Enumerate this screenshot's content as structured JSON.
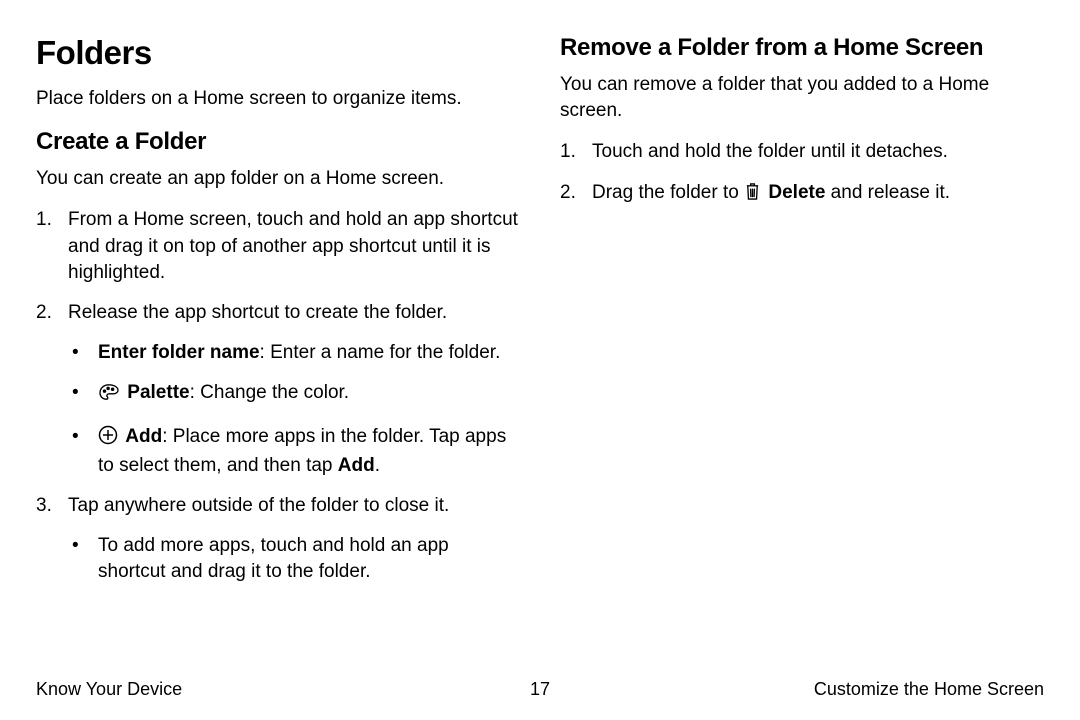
{
  "left": {
    "title": "Folders",
    "intro": "Place folders on a Home screen to organize items.",
    "createHeading": "Create a Folder",
    "createIntro": "You can create an app folder on a Home screen.",
    "steps": {
      "s1": "From a Home screen, touch and hold an app shortcut and drag it on top of another app shortcut until it is highlighted.",
      "s2": "Release the app shortcut to create the folder.",
      "s2b1_label": "Enter folder name",
      "s2b1_rest": ": Enter a name for the folder.",
      "s2b2_label": "Palette",
      "s2b2_rest": ": Change the color.",
      "s2b3_label": "Add",
      "s2b3_rest1": ": Place more apps in the folder. Tap apps to select them, and then tap ",
      "s2b3_add": "Add",
      "s2b3_rest2": ".",
      "s3": "Tap anywhere outside of the folder to close it.",
      "s3b1": "To add more apps, touch and hold an app shortcut and drag it to the folder."
    }
  },
  "right": {
    "heading": "Remove a Folder from a Home Screen",
    "intro": "You can remove a folder that you added to a Home screen.",
    "steps": {
      "r1": "Touch and hold the folder until it detaches.",
      "r2_pre": "Drag the folder to ",
      "r2_label": "Delete",
      "r2_post": " and release it."
    }
  },
  "footer": {
    "left": "Know Your Device",
    "page": "17",
    "right": "Customize the Home Screen"
  }
}
